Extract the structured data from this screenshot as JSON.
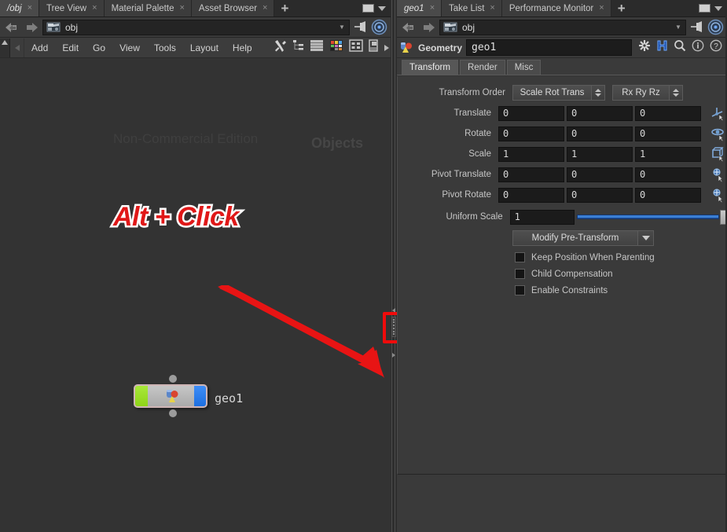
{
  "left_pane": {
    "tabs": [
      {
        "label": "/obj",
        "closable": true,
        "active": true
      },
      {
        "label": "Tree View",
        "closable": true,
        "active": false
      },
      {
        "label": "Material Palette",
        "closable": true,
        "active": false
      },
      {
        "label": "Asset Browser",
        "closable": true,
        "active": false
      }
    ],
    "tab_add_label": "+",
    "close_glyph": "×",
    "path": {
      "value": "obj",
      "icon": "network-obj-icon",
      "dropdown_glyph": "▼"
    },
    "menu": [
      "Add",
      "Edit",
      "Go",
      "View",
      "Tools",
      "Layout",
      "Help"
    ],
    "toolbar_icons": [
      "wrench-icon",
      "hierarchy-icon",
      "list-layout-icon",
      "color-palette-icon",
      "grid-view-icon",
      "snapshot-icon"
    ],
    "watermark": {
      "edition": "Non-Commercial Edition",
      "context": "Objects"
    },
    "node": {
      "name": "geo1",
      "type_icon": "geometry-node-icon"
    },
    "annotation": {
      "text": "Alt + Click",
      "color": "#e01818",
      "outline": "#ffffff"
    }
  },
  "right_pane": {
    "tabs": [
      {
        "label": "geo1",
        "closable": true,
        "active": true
      },
      {
        "label": "Take List",
        "closable": true,
        "active": false
      },
      {
        "label": "Performance Monitor",
        "closable": true,
        "active": false
      }
    ],
    "tab_add_label": "+",
    "close_glyph": "×",
    "path": {
      "value": "obj",
      "icon": "network-obj-icon",
      "dropdown_glyph": "▼"
    },
    "parm_header": {
      "node_type": "Geometry",
      "node_name": "geo1",
      "icon": "geometry-node-icon",
      "icons": [
        "gear-asterisk-icon",
        "houdini-h-icon",
        "magnifier-icon",
        "info-icon",
        "help-icon"
      ]
    },
    "parm_tabs": [
      {
        "label": "Transform",
        "active": true
      },
      {
        "label": "Render",
        "active": false
      },
      {
        "label": "Misc",
        "active": false
      }
    ],
    "parameters": {
      "transform_order": {
        "label": "Transform Order",
        "srt": "Scale Rot Trans",
        "rotation": "Rx Ry Rz"
      },
      "vector_rows": [
        {
          "label": "Translate",
          "values": [
            "0",
            "0",
            "0"
          ],
          "handle_icon": "translate-handle-icon"
        },
        {
          "label": "Rotate",
          "values": [
            "0",
            "0",
            "0"
          ],
          "handle_icon": "rotate-handle-icon"
        },
        {
          "label": "Scale",
          "values": [
            "1",
            "1",
            "1"
          ],
          "handle_icon": "scale-handle-icon"
        },
        {
          "label": "Pivot Translate",
          "values": [
            "0",
            "0",
            "0"
          ],
          "handle_icon": "pivot-translate-handle-icon"
        },
        {
          "label": "Pivot Rotate",
          "values": [
            "0",
            "0",
            "0"
          ],
          "handle_icon": "pivot-rotate-handle-icon"
        }
      ],
      "uniform_scale": {
        "label": "Uniform Scale",
        "value": "1",
        "slider_percent": 100
      },
      "modify_pre_transform": {
        "label": "Modify Pre-Transform",
        "dropdown_glyph": "▼"
      },
      "checkboxes": [
        {
          "label": "Keep Position When Parenting",
          "checked": false
        },
        {
          "label": "Child Compensation",
          "checked": false
        },
        {
          "label": "Enable Constraints",
          "checked": false
        }
      ]
    }
  },
  "splitter": {
    "name": "pane-splitter",
    "highlight_color": "#f00b0b"
  }
}
